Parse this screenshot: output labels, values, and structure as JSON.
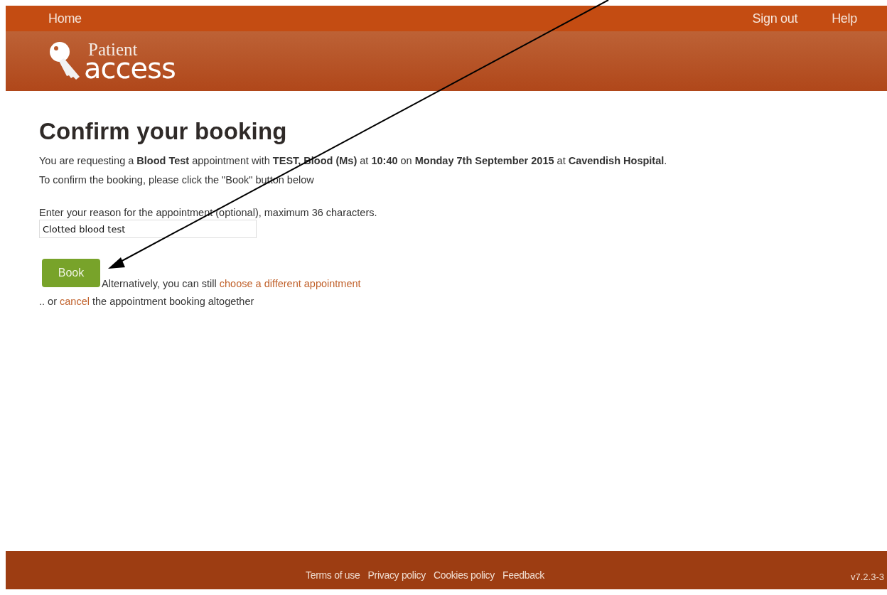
{
  "nav": {
    "left": [
      {
        "label": "Home"
      }
    ],
    "right": [
      {
        "label": "Sign out"
      },
      {
        "label": "Help"
      }
    ]
  },
  "logo": {
    "line1": "Patient",
    "line2": "access"
  },
  "heading": "Confirm your booking",
  "summary": "You are requesting a **Blood Test** appointment with **TEST, Blood (Ms)** at **10:40** on **Monday 7th September 2015** at **Cavendish Hospital**.",
  "instruction": "To confirm the booking, please click the \"Book\" button below",
  "reason": {
    "label": "Enter your reason for the appointment (optional), maximum 36 characters.",
    "value": "Clotted blood test"
  },
  "book_button": "Book",
  "alternative": {
    "before": "Alternatively, you can still ",
    "link": "choose a different appointment"
  },
  "cancel_line": {
    "before": ".. or ",
    "link": "cancel",
    "after": " the appointment booking altogether"
  },
  "footer": {
    "links": [
      {
        "label": "Terms of use"
      },
      {
        "label": "Privacy policy"
      },
      {
        "label": "Cookies policy"
      },
      {
        "label": "Feedback"
      }
    ],
    "version": "v7.2.3-3"
  }
}
